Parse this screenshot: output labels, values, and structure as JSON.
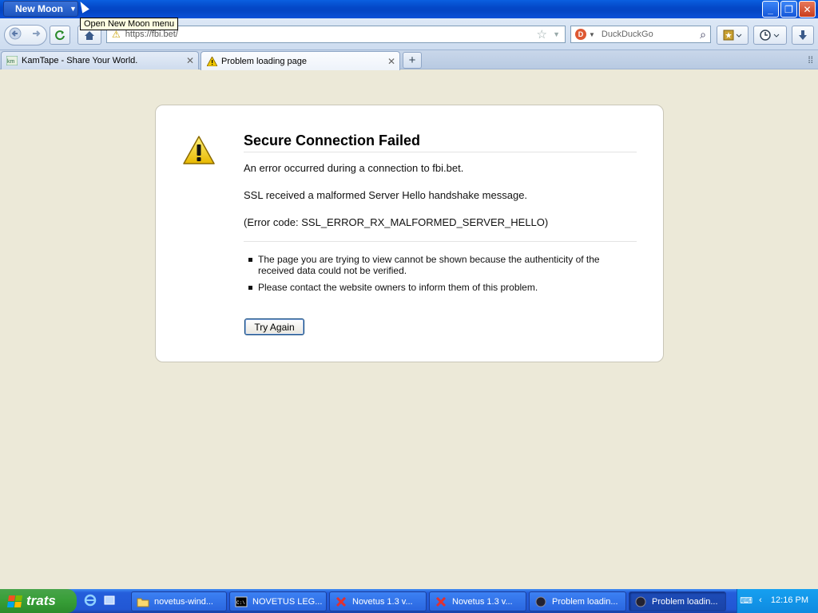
{
  "window": {
    "menu_button": "New Moon",
    "tooltip": "Open New Moon menu",
    "controls": {
      "minimize": "_",
      "maximize": "❐",
      "close": "✕"
    }
  },
  "navigation": {
    "url": "https://fbi.bet/",
    "search_placeholder": "DuckDuckGo"
  },
  "tabs": [
    {
      "label": "KamTape - Share Your World.",
      "active": false
    },
    {
      "label": "Problem loading page",
      "active": true
    }
  ],
  "error": {
    "title": "Secure Connection Failed",
    "line1": "An error occurred during a connection to fbi.bet.",
    "line2": "SSL received a malformed Server Hello handshake message.",
    "line3": "(Error code: SSL_ERROR_RX_MALFORMED_SERVER_HELLO)",
    "bullets": [
      "The page you are trying to view cannot be shown because the authenticity of the received data could not be verified.",
      "Please contact the website owners to inform them of this problem."
    ],
    "button": "Try Again"
  },
  "taskbar": {
    "start_label": "trats",
    "tasks": [
      {
        "label": "novetus-wind..."
      },
      {
        "label": "NOVETUS LEG..."
      },
      {
        "label": "Novetus 1.3 v..."
      },
      {
        "label": "Novetus 1.3 v..."
      },
      {
        "label": "Problem loadin..."
      },
      {
        "label": "Problem loadin..."
      }
    ],
    "clock": "12:16 PM"
  }
}
